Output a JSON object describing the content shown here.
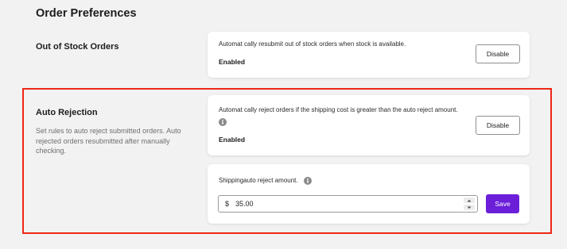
{
  "page": {
    "title": "Order Preferences"
  },
  "out_of_stock": {
    "section_title": "Out of Stock Orders",
    "description": "Automat cally resubmit out of stock orders when stock is available.",
    "status": "Enabled",
    "button_label": "Disable"
  },
  "auto_rejection": {
    "section_title": "Auto Rejection",
    "section_description": "Set rules to auto reject submitted orders. Auto rejected orders resubmitted after manually checking.",
    "description": "Automat cally reject orders if the shipping cost is greater than the auto reject amount.",
    "status": "Enabled",
    "button_label": "Disable",
    "amount_card": {
      "label": "Shippingauto reject amount.",
      "currency_symbol": "$",
      "value": "35.00",
      "save_label": "Save"
    }
  },
  "colors": {
    "highlight_border": "#ee2716",
    "primary_button": "#6b1fd8",
    "background": "#f2f2f2"
  },
  "icons": {
    "info": "info-icon",
    "increment": "chevron-up-icon",
    "decrement": "chevron-down-icon"
  }
}
